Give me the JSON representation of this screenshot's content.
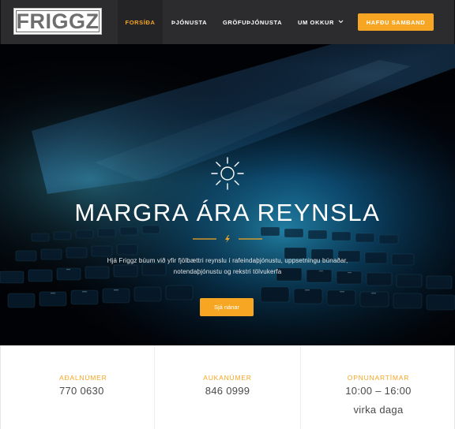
{
  "header": {
    "logo_text": "FRIGGZ",
    "nav": [
      {
        "label": "FORSÍÐA",
        "active": true
      },
      {
        "label": "ÞJÓNUSTA",
        "active": false
      },
      {
        "label": "GRÖFUÞJÓNUSTA",
        "active": false
      },
      {
        "label": "UM OKKUR",
        "active": false,
        "has_dropdown": true
      }
    ],
    "cta_label": "HAFÐU SAMBAND"
  },
  "hero": {
    "icon": "sun-icon",
    "title": "MARGRA ÁRA REYNSLA",
    "divider_icon": "lightning-icon",
    "text_line1": "Hjá Friggz búum við yfir fjölbættri reynslu í rafeindaþjónustu, uppsetningu búnaðar,",
    "text_line2": "notendaþjónustu og rekstri tölvukerfa",
    "button_label": "Sjá nánar"
  },
  "info": [
    {
      "label": "AÐALNÚMER",
      "value": "770 0630"
    },
    {
      "label": "AUKANÚMER",
      "value": "846 0999"
    },
    {
      "label": "OPNUNARTÍMAR",
      "value": "10:00 – 16:00",
      "value2": "virka daga"
    }
  ],
  "colors": {
    "accent": "#f6a623",
    "header_bg": "#2c2c2e",
    "hero_bg": "#02040a"
  }
}
